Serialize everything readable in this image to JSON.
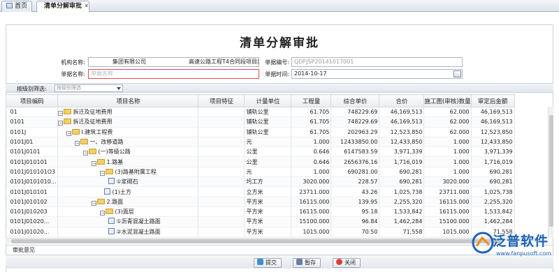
{
  "tabs": [
    {
      "label": "首页"
    },
    {
      "label": "清单分解审批"
    }
  ],
  "page_title": "清单分解审批",
  "form": {
    "org_label": "机构名称:",
    "org_value": "集团有限公司",
    "org_value_2": "高速公路工程T4合同段项目部",
    "docno_label": "单据编号:",
    "docno_value": "QDFJSP20141017001",
    "docname_label": "单据名称:",
    "docname_placeholder": "单据名称",
    "doctime_label": "单据时间:",
    "doctime_value": "2014-10-17"
  },
  "filter": {
    "label": "按级别筛选:",
    "placeholder": "按级别筛选"
  },
  "table": {
    "columns": [
      "项目编码",
      "项目名称",
      "项目特征",
      "计量单位",
      "工程量",
      "综合单价",
      "合价",
      "施工图(审核)数量",
      "审定后金额"
    ],
    "rows": [
      {
        "code": "01",
        "name": "拆迁及征地费用",
        "feature": "",
        "unit": "铺轨公里",
        "qty": "61.705",
        "price": "748229.69",
        "total": "46,169,513",
        "audit_qty": "62.000",
        "audit_amt": "46,169,513"
      },
      {
        "code": "0101",
        "name": "拆迁及征地费用",
        "feature": "",
        "unit": "铺轨公里",
        "qty": "61.705",
        "price": "748229.69",
        "total": "46,169,513",
        "audit_qty": "62.000",
        "audit_amt": "46,169,513"
      },
      {
        "code": "0101J",
        "name": "Ⅰ.建筑工程费",
        "feature": "",
        "unit": "铺轨公里",
        "qty": "61.705",
        "price": "202963.29",
        "total": "12,523,850",
        "audit_qty": "62.000",
        "audit_amt": "12,523,850"
      },
      {
        "code": "0101J01",
        "name": "一、改移道路",
        "feature": "",
        "unit": "元",
        "qty": "1.000",
        "price": "12433850.00",
        "total": "12,433,850",
        "audit_qty": "1.000",
        "audit_amt": "12,433,850"
      },
      {
        "code": "0101J0101",
        "name": "(一)等级公路",
        "feature": "",
        "unit": "公里",
        "qty": "0.646",
        "price": "6147583.59",
        "total": "3,971,339",
        "audit_qty": "1.000",
        "audit_amt": "3,971,339"
      },
      {
        "code": "0101J010101",
        "name": "1.路基",
        "feature": "",
        "unit": "公里",
        "qty": "0.646",
        "price": "2656376.16",
        "total": "1,716,019",
        "audit_qty": "1.000",
        "audit_amt": "1,716,019"
      },
      {
        "code": "0101J010101O3",
        "name": "(3)路基附属工程",
        "feature": "",
        "unit": "元",
        "qty": "1.000",
        "price": "690281.00",
        "total": "690,281",
        "audit_qty": "1.000",
        "audit_amt": "690,281"
      },
      {
        "code": "0101J0101010...",
        "name": "①浆砌石",
        "feature": "",
        "unit": "圬工方",
        "qty": "3020.000",
        "price": "228.57",
        "total": "690,281",
        "audit_qty": "3020.000",
        "audit_amt": "690,281"
      },
      {
        "code": "0101J010101",
        "name": "(1)土方",
        "feature": "",
        "unit": "立方米",
        "qty": "23711.000",
        "price": "43.26",
        "total": "1,025,738",
        "audit_qty": "23711.000",
        "audit_amt": "1,025,738"
      },
      {
        "code": "0101J010102",
        "name": "2.路面",
        "feature": "",
        "unit": "平方米",
        "qty": "16115.000",
        "price": "139.95",
        "total": "2,255,320",
        "audit_qty": "16115.000",
        "audit_amt": "2,255,320"
      },
      {
        "code": "0101J010203",
        "name": "(3)面层",
        "feature": "",
        "unit": "平方米",
        "qty": "16115.000",
        "price": "95.18",
        "total": "1,533,842",
        "audit_qty": "16115.000",
        "audit_amt": "1,533,842"
      },
      {
        "code": "0101J01020...",
        "name": "①沥青混凝土路面",
        "feature": "",
        "unit": "平方米",
        "qty": "15100.000",
        "price": "96.84",
        "total": "1,462,284",
        "audit_qty": "15100.000",
        "audit_amt": "1,462,284"
      },
      {
        "code": "0101J01020...",
        "name": "②水泥混凝土路面",
        "feature": "",
        "unit": "平方米",
        "qty": "1015.000",
        "price": "70.50",
        "total": "71,558",
        "audit_qty": "1015.000",
        "audit_amt": "71,558"
      }
    ]
  },
  "approval_label": "审批意见",
  "buttons": {
    "submit": "提交",
    "save": "暂存",
    "close": "关闭"
  },
  "logo": {
    "text": "泛普软件",
    "url": "www.fanpusoft.com"
  },
  "colors": {
    "accent": "#1e64b6",
    "required_border": "#e24c4c",
    "folder": "#f3cf6b"
  }
}
